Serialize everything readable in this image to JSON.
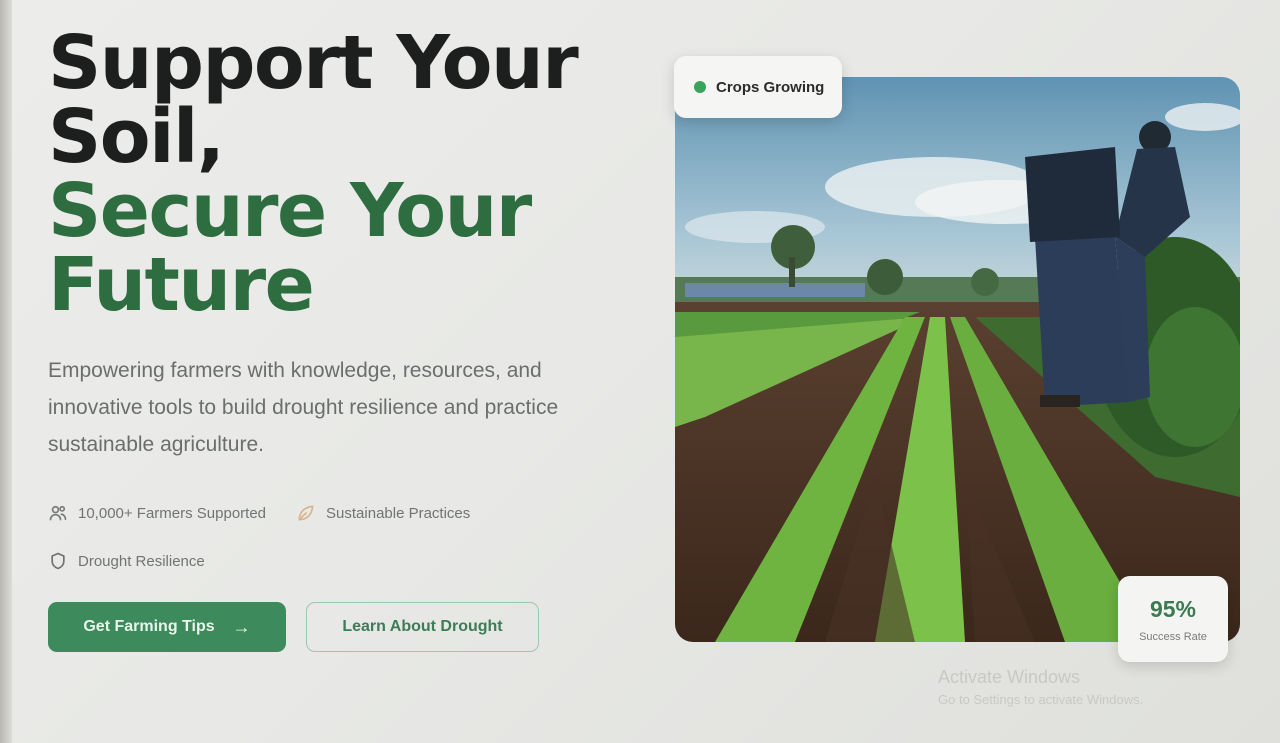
{
  "hero": {
    "headline_line1": "Support Your",
    "headline_line2": "Soil,",
    "headline_line3": "Secure Your",
    "headline_line4": "Future",
    "subtitle": "Empowering farmers with knowledge, resources, and innovative tools to build drought resilience and practice sustainable agriculture."
  },
  "features": [
    {
      "icon": "users-icon",
      "label": "10,000+ Farmers Supported"
    },
    {
      "icon": "leaf-icon",
      "label": "Sustainable Practices"
    },
    {
      "icon": "shield-icon",
      "label": "Drought Resilience"
    }
  ],
  "buttons": {
    "primary_label": "Get Farming Tips",
    "primary_icon": "arrow-right-icon",
    "secondary_label": "Learn About Drought"
  },
  "image_card": {
    "status_badge": "Crops Growing",
    "status_color": "#3aa35b",
    "stat_value": "95%",
    "stat_caption": "Success Rate"
  },
  "watermark": {
    "title": "Activate Windows",
    "subtitle": "Go to Settings to activate Windows."
  },
  "colors": {
    "headline_dark": "#1c1f1d",
    "headline_green": "#2e6d3f",
    "primary_button": "#3d8a5c",
    "accent_green": "#3b7a52"
  }
}
